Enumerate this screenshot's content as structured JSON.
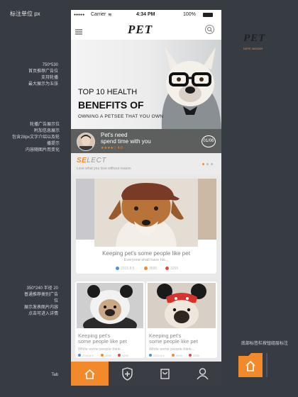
{
  "annotations": {
    "title": "标注单位 px",
    "hero_note": [
      "750*530",
      "首页推荐广告位",
      "支持轮播",
      "最大展示为五张"
    ],
    "adbar_note": [
      "轮播广告展示位",
      "附加信息展示",
      "包含28px文字介绍以及轮播提示",
      "内容随图片而变化"
    ],
    "card_note": [
      "350*240 半径 20",
      "普通推荐类别广告位",
      "展示发表图片内容",
      "点击可进入详情"
    ],
    "tab_note": "Tab",
    "bottom_note": "底部标签栏按钮组层标注",
    "brand_caption": "NZPE      4000009"
  },
  "status_bar": {
    "carrier": "Carrier",
    "time": "4:34 PM",
    "battery": "100%"
  },
  "nav": {
    "logo": "PET"
  },
  "hero": {
    "line1": "TOP 10 HEALTH",
    "line2": "BENEFITS OF",
    "line3": "OWNING A PETSEE THAT YOU OWN"
  },
  "ad_bar": {
    "line1": "Pet's need",
    "line2": "spend time with you",
    "rating": "★★★★☆ 4.0",
    "page_indicator": "01/06"
  },
  "select": {
    "title_prefix": "SE",
    "title_rest": "LECT",
    "subtitle": "Love what you love without reason"
  },
  "feature_card": {
    "title": "Keeping pet's some people like pet",
    "subtitle": "Everyone shall have his...",
    "stats": [
      "2015.8.5",
      "3595",
      "3255"
    ]
  },
  "small_cards": [
    {
      "title1": "Keeping pet's",
      "title2": "some people like pet",
      "subtitle": "While some people think...",
      "stats": [
        "2015.8.5",
        "3595",
        "3255"
      ]
    },
    {
      "title1": "Keeping pet's",
      "title2": "some people like pet",
      "subtitle": "While some people think...",
      "stats": [
        "2015.8.5",
        "3595",
        "3255"
      ]
    }
  ],
  "colors": {
    "accent": "#f28a2c",
    "background": "#373b42",
    "tabbar": "#3a3d44"
  },
  "tabs": [
    "home-icon",
    "pet-shield-icon",
    "shop-bag-icon",
    "profile-icon"
  ]
}
